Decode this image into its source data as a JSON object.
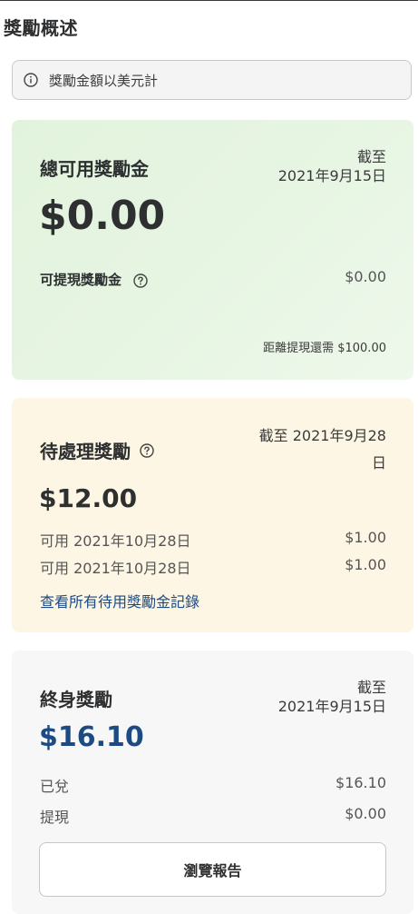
{
  "page": {
    "title": "獎勵概述"
  },
  "info_banner": {
    "icon": "info-icon",
    "text": "獎勵金額以美元計"
  },
  "available_card": {
    "title": "總可用獎勵金",
    "asof_label": "截至",
    "asof_date": "2021年9月15日",
    "amount": "$0.00",
    "withdrawable_label": "可提現獎勵金",
    "withdrawable_value": "$0.00",
    "help_icon": "question-circle-icon",
    "threshold_text": "距離提現還需 $100.00",
    "color": "#e4f4df"
  },
  "pending_card": {
    "title": "待處理獎勵",
    "help_icon": "question-circle-icon",
    "asof_line1": "截至 2021年9月28",
    "asof_line2": "日",
    "amount": "$12.00",
    "items": [
      {
        "label": "可用 2021年10月28日",
        "value": "$1.00"
      },
      {
        "label": "可用 2021年10月28日",
        "value": "$1.00"
      }
    ],
    "view_all_link": "查看所有待用獎勵金記錄",
    "color": "#fdf6e4"
  },
  "lifetime_card": {
    "title": "終身獎勵",
    "asof_label": "截至",
    "asof_date": "2021年9月15日",
    "amount": "$16.10",
    "amount_color": "#1c4a83",
    "rows": [
      {
        "label": "已兌",
        "value": "$16.10"
      },
      {
        "label": "提現",
        "value": "$0.00"
      }
    ],
    "report_button": "瀏覽報告",
    "color": "#f7f7f7"
  }
}
